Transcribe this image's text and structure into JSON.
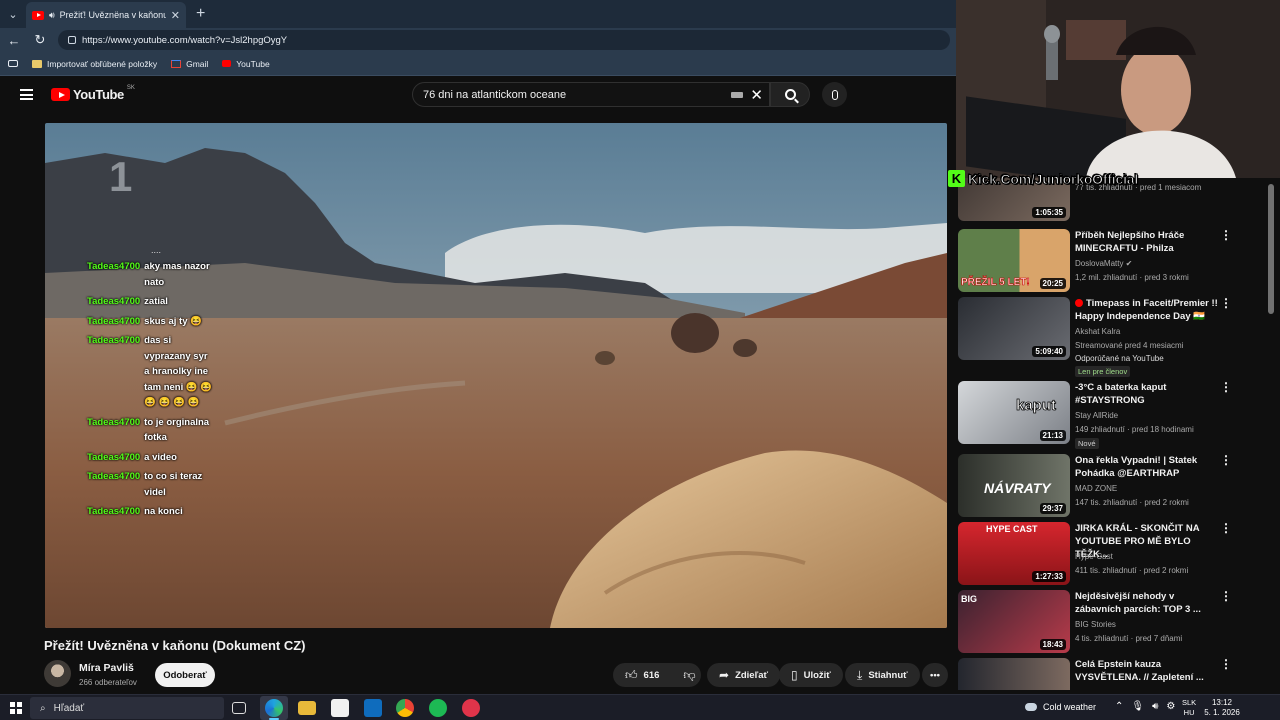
{
  "browser": {
    "tab_title": "Prežiť! Uvěznëna v kaňonu (D",
    "url": "https://www.youtube.com/watch?v=Jsl2hpgOygY",
    "favorites": [
      {
        "label": "Importovať obľúbené položky",
        "icon": "folder-icon"
      },
      {
        "label": "Gmail",
        "icon": "gmail-icon"
      },
      {
        "label": "YouTube",
        "icon": "youtube-icon"
      }
    ]
  },
  "youtube": {
    "logo_text": "YouTube",
    "region": "SK",
    "search_value": "76 dni na atlantickom oceane"
  },
  "video": {
    "overlay_digit": "1",
    "title": "Přežít! Uvězněna v kaňonu (Dokument CZ)",
    "channel": "Míra Pavliš",
    "subscribers": "266 odberateľov",
    "subscribe_label": "Odoberať",
    "likes": "616",
    "share_label": "Zdieľať",
    "save_label": "Uložiť",
    "download_label": "Stiahnuť"
  },
  "chat": {
    "dots": "....",
    "messages": [
      {
        "user": "Tadeas4700",
        "text": "aky mas nazor nato"
      },
      {
        "user": "Tadeas4700",
        "text": "zatial"
      },
      {
        "user": "Tadeas4700",
        "text": "skus aj ty 😆"
      },
      {
        "user": "Tadeas4700",
        "text": "das si vyprazany syr a hranolky ine tam neni 😆 😆 😆 😆 😆 😆"
      },
      {
        "user": "Tadeas4700",
        "text": "to je orginalna fotka"
      },
      {
        "user": "Tadeas4700",
        "text": "a video"
      },
      {
        "user": "Tadeas4700",
        "text": "to co si teraz videl"
      },
      {
        "user": "Tadeas4700",
        "text": "na konci"
      }
    ]
  },
  "stream_overlay": {
    "kick_text": "Kick.Com/JuniorkoOfficial",
    "kick_letter": "K"
  },
  "recommendations": [
    {
      "title": "",
      "channel": "",
      "meta": "77 tis. zhliadnutí · pred 1 mesiacom",
      "duration": "1:05:35"
    },
    {
      "title": "Příběh Nejlepšího Hráče MINECRAFTU - Philza",
      "channel": "DoslovaMatty ✔",
      "meta": "1,2 mil. zhliadnutí · pred 3 rokmi",
      "duration": "20:25",
      "thumb_text": "PŘEŽIL 5 LET!"
    },
    {
      "title": "Timepass in Faceit/Premier !! Happy Independence Day 🇮🇳",
      "channel": "Akshat Kalra",
      "meta": "Streamované pred 4 mesiacmi",
      "extra": "Odporúčané na YouTube",
      "badge": "Len pre členov",
      "duration": "5:09:40"
    },
    {
      "title": "-3°C a baterka kaput #STAYSTRONG",
      "channel": "Stay AllRide",
      "meta": "149 zhliadnutí · pred 18 hodinami",
      "badge": "Nové",
      "duration": "21:13",
      "thumb_text": "kaput"
    },
    {
      "title": "Ona řekla Vypadni! | Statek Pohádka @EARTHRAP",
      "channel": "MAD ZONE",
      "meta": "147 tis. zhliadnutí · pred 2 rokmi",
      "duration": "29:37",
      "thumb_text": "NÁVRATY"
    },
    {
      "title": "JIRKA KRÁL - SKONČIT NA YOUTUBE PRO MĚ BYLO TĚŽK...",
      "channel": "Hype-Cast",
      "meta": "411 tis. zhliadnutí · pred 2 rokmi",
      "duration": "1:27:33",
      "thumb_text": "HYPE CAST"
    },
    {
      "title": "Nejděsivější nehody v zábavních parcích: TOP 3 ...",
      "channel": "BIG Stories",
      "meta": "4 tis. zhliadnutí · pred 7 dňami",
      "duration": "18:43",
      "thumb_text": "BIG"
    },
    {
      "title": "Celá Epstein kauza VYSVĚTLENA. // Zapletení ...",
      "channel": "",
      "meta": "",
      "duration": ""
    }
  ],
  "taskbar": {
    "search_placeholder": "Hľadať",
    "weather": "Cold weather",
    "lang_top": "SLK",
    "lang_bottom": "HU",
    "time": "13:12",
    "date": "5. 1. 2026"
  },
  "colors": {
    "accent_red": "#ff0000",
    "kick_green": "#53fc18",
    "chat_user": "#53fc18"
  }
}
